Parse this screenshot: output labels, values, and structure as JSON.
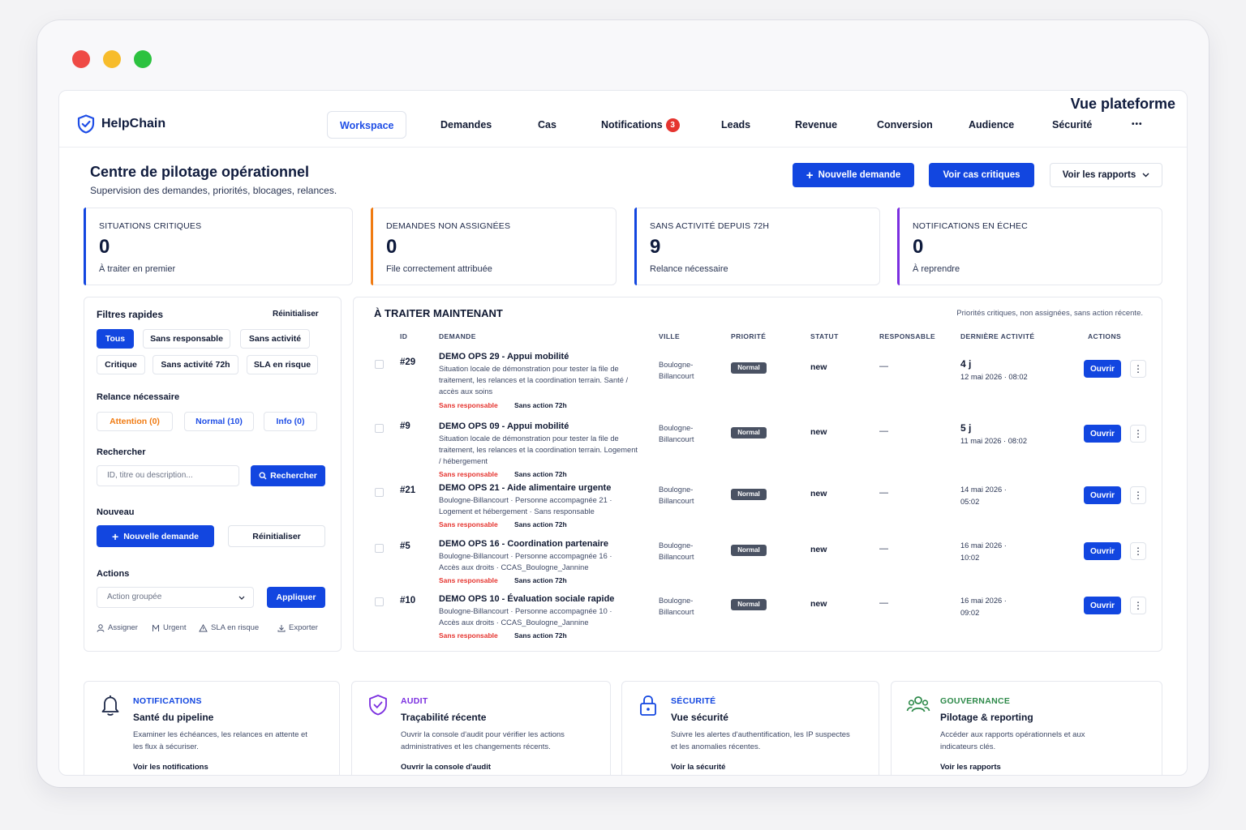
{
  "app": {
    "name": "HelpChain",
    "platform_title": "Vue plateforme"
  },
  "nav": {
    "items": [
      {
        "label": "Workspace"
      },
      {
        "label": "Demandes"
      },
      {
        "label": "Cas"
      },
      {
        "label": "Notifications",
        "badge": "3"
      },
      {
        "label": "Leads"
      },
      {
        "label": "Revenue"
      },
      {
        "label": "Conversion"
      },
      {
        "label": "Audience"
      },
      {
        "label": "Sécurité"
      }
    ],
    "more": "•••"
  },
  "header": {
    "title": "Centre de pilotage opérationnel",
    "subtitle": "Supervision des demandes, priorités, blocages, relances.",
    "new_request": "Nouvelle demande",
    "critical_cases": "Voir cas critiques",
    "reports": "Voir les rapports"
  },
  "kpis": [
    {
      "label": "SITUATIONS CRITIQUES",
      "value": "0",
      "sub": "À traiter en premier",
      "color": "#1246e0"
    },
    {
      "label": "DEMANDES NON ASSIGNÉES",
      "value": "0",
      "sub": "File correctement attribuée",
      "color": "#f07b12"
    },
    {
      "label": "SANS ACTIVITÉ DEPUIS 72H",
      "value": "9",
      "sub": "Relance nécessaire",
      "color": "#1246e0"
    },
    {
      "label": "NOTIFICATIONS EN ÉCHEC",
      "value": "0",
      "sub": "À reprendre",
      "color": "#7b2fe0"
    }
  ],
  "filters": {
    "title": "Filtres rapides",
    "reset": "Réinitialiser",
    "chips": [
      "Tous",
      "Sans responsable",
      "Sans activité",
      "Critique",
      "Sans activité 72h",
      "SLA en risque"
    ],
    "relance_title": "Relance nécessaire",
    "relance": [
      "Attention (0)",
      "Normal (10)",
      "Info (0)"
    ],
    "search_title": "Rechercher",
    "search_placeholder": "ID, titre ou description...",
    "search_button": "Rechercher",
    "new_title": "Nouveau",
    "new_button": "Nouvelle demande",
    "new_reset": "Réinitialiser",
    "actions_title": "Actions",
    "bulk_select": "Action groupée",
    "apply": "Appliquer",
    "mini_actions": [
      "Assigner",
      "Urgent",
      "SLA en risque",
      "Exporter"
    ]
  },
  "table": {
    "title": "À TRAITER MAINTENANT",
    "subtitle": "Priorités critiques, non assignées, sans action récente.",
    "headers": [
      "ID",
      "DEMANDE",
      "VILLE",
      "PRIORITÉ",
      "STATUT",
      "RESPONSABLE",
      "DERNIÈRE ACTIVITÉ",
      "ACTIONS"
    ],
    "open_label": "Ouvrir",
    "rows": [
      {
        "id": "#29",
        "title": "DEMO OPS 29 - Appui mobilité",
        "desc": "Situation locale de démonstration pour tester la file de traitement, les relances et la coordination terrain. Santé / accès aux soins",
        "tag1": "Sans responsable",
        "tag2": "Sans action 72h",
        "city": "Boulogne-Billancourt",
        "priority": "Normal",
        "status": "new",
        "responsible": "—",
        "activity_main": "4 j",
        "activity_sub": "12 mai 2026 · 08:02"
      },
      {
        "id": "#9",
        "title": "DEMO OPS 09 - Appui mobilité",
        "desc": "Situation locale de démonstration pour tester la file de traitement, les relances et la coordination terrain. Logement / hébergement",
        "tag1": "Sans responsable",
        "tag2": "Sans action 72h",
        "city": "Boulogne-Billancourt",
        "priority": "Normal",
        "status": "new",
        "responsible": "—",
        "activity_main": "5 j",
        "activity_sub": "11 mai 2026 · 08:02"
      },
      {
        "id": "#21",
        "title": "DEMO OPS 21 - Aide alimentaire urgente",
        "desc": "Boulogne-Billancourt · Personne accompagnée 21 · Logement et hébergement · Sans responsable",
        "tag1": "Sans responsable",
        "tag2": "Sans action 72h",
        "city": "Boulogne-Billancourt",
        "priority": "Normal",
        "status": "new",
        "responsible": "—",
        "activity_main": "",
        "activity_sub": "14 mai 2026 · 05:02"
      },
      {
        "id": "#5",
        "title": "DEMO OPS 16 - Coordination partenaire",
        "desc": "Boulogne-Billancourt · Personne accompagnée 16 · Accès aux droits · CCAS_Boulogne_Jannine",
        "tag1": "Sans responsable",
        "tag2": "Sans action 72h",
        "city": "Boulogne-Billancourt",
        "priority": "Normal",
        "status": "new",
        "responsible": "—",
        "activity_main": "",
        "activity_sub": "16 mai 2026 · 10:02"
      },
      {
        "id": "#10",
        "title": "DEMO OPS 10 - Évaluation sociale rapide",
        "desc": "Boulogne-Billancourt · Personne accompagnée 10 · Accès aux droits · CCAS_Boulogne_Jannine",
        "tag1": "Sans responsable",
        "tag2": "Sans action 72h",
        "city": "Boulogne-Billancourt",
        "priority": "Normal",
        "status": "new",
        "responsible": "—",
        "activity_main": "",
        "activity_sub": "16 mai 2026 · 09:02"
      }
    ]
  },
  "cards": [
    {
      "icon": "bell-icon",
      "category": "NOTIFICATIONS",
      "title": "Santé du pipeline",
      "desc": "Examiner les échéances, les relances en attente et les flux à sécuriser.",
      "link": "Voir les notifications",
      "color": "#1246e0"
    },
    {
      "icon": "shield-check-icon",
      "category": "AUDIT",
      "title": "Traçabilité récente",
      "desc": "Ouvrir la console d'audit pour vérifier les actions administratives et les changements récents.",
      "link": "Ouvrir la console d'audit",
      "color": "#7b2fe0"
    },
    {
      "icon": "lock-icon",
      "category": "SÉCURITÉ",
      "title": "Vue sécurité",
      "desc": "Suivre les alertes d'authentification, les IP suspectes et les anomalies récentes.",
      "link": "Voir la sécurité",
      "color": "#1246e0"
    },
    {
      "icon": "users-icon",
      "category": "GOUVERNANCE",
      "title": "Pilotage & reporting",
      "desc": "Accéder aux rapports opérationnels et aux indicateurs clés.",
      "link": "Voir les rapports",
      "color": "#2e8a4a"
    }
  ]
}
